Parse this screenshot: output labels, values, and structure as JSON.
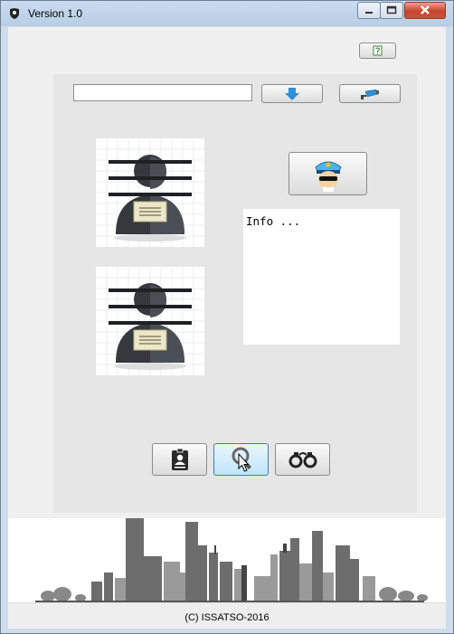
{
  "window": {
    "title": "Version 1.0"
  },
  "search": {
    "value": "",
    "placeholder": ""
  },
  "info": {
    "text": "Info ..."
  },
  "footer": {
    "copyright": "(C) ISSATSO-2016"
  },
  "icons": {
    "app": "shield-icon",
    "help": "help-icon",
    "download": "arrow-down-icon",
    "camera": "security-camera-icon",
    "police": "police-officer-icon",
    "suspect": "suspect-mugshot-icon",
    "idcard": "id-badge-icon",
    "search": "magnifier-cursor-icon",
    "handcuffs": "handcuffs-icon"
  },
  "colors": {
    "accent": "#2f8fd8",
    "close": "#c8442c",
    "mugshot": "#35383d"
  }
}
